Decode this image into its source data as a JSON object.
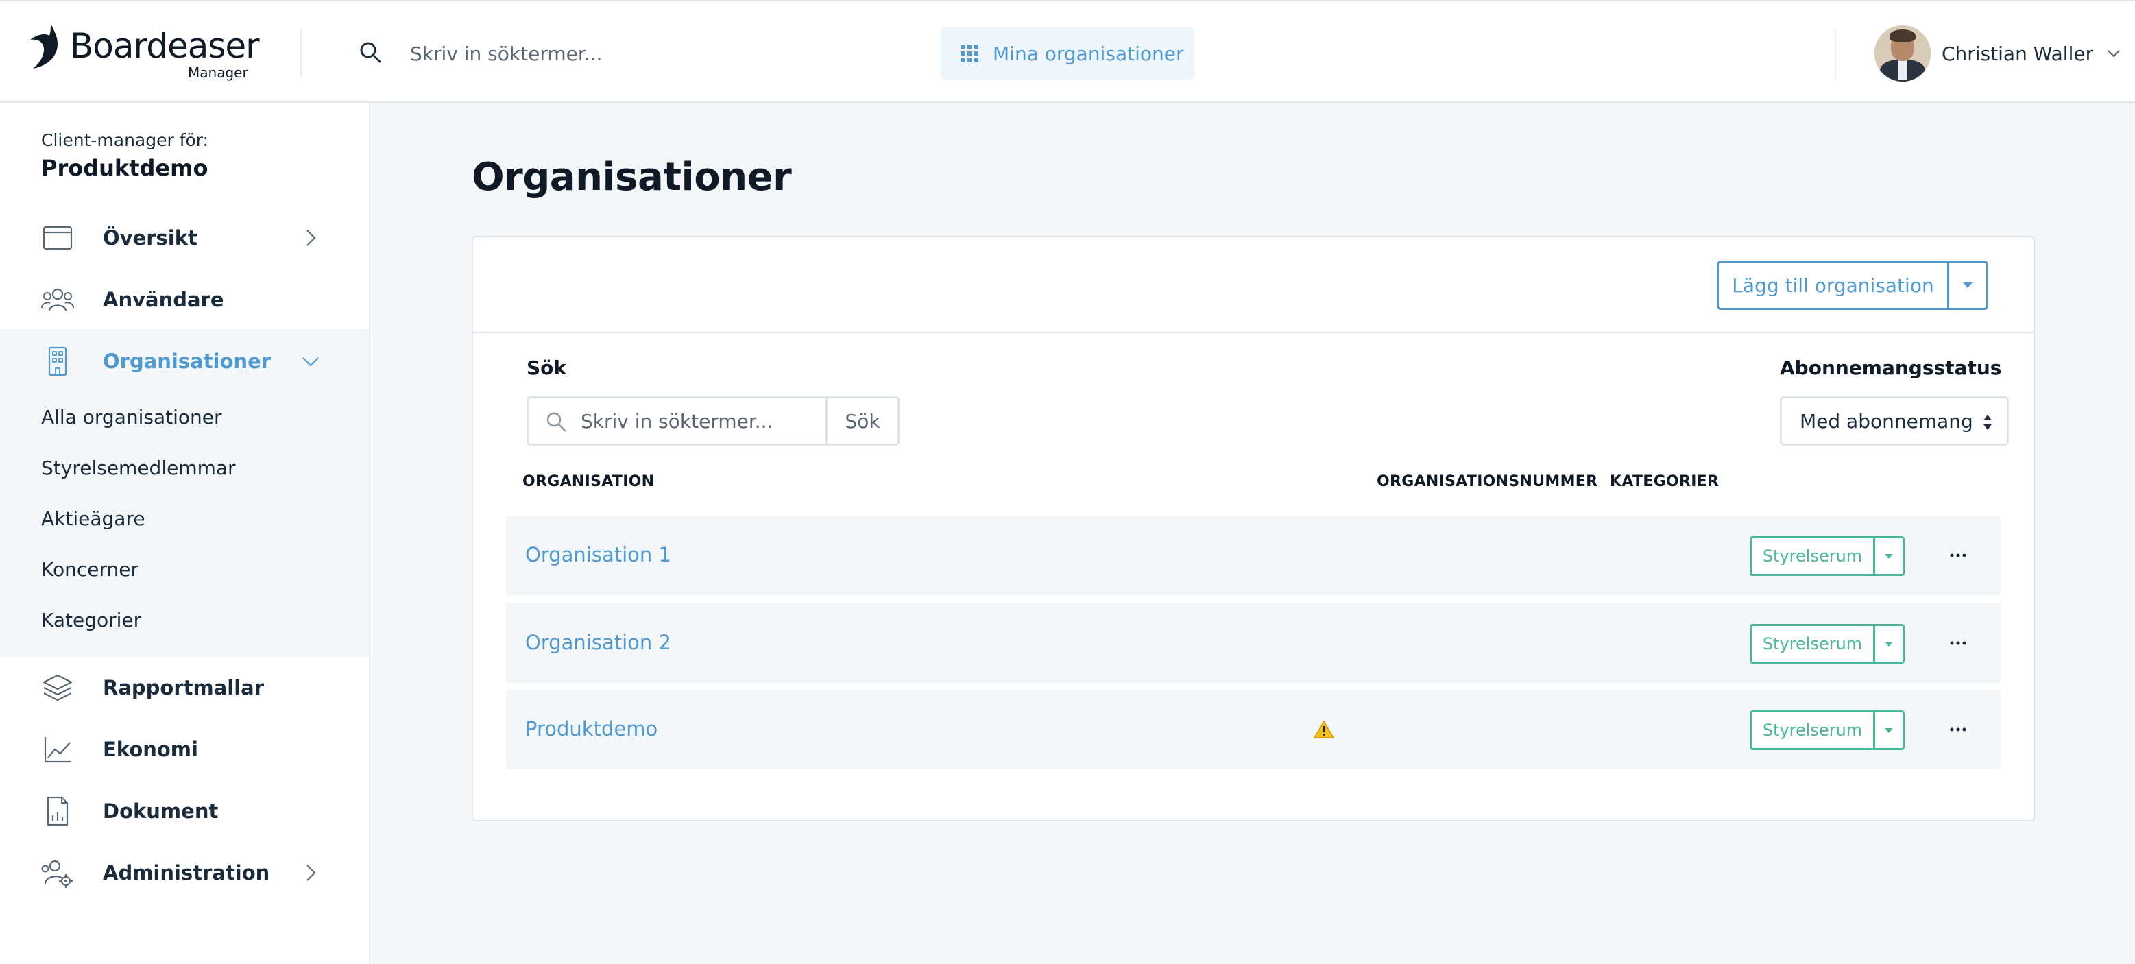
{
  "header": {
    "brand": "Boardeaser",
    "brand_sub": "Manager",
    "search_placeholder": "Skriv in söktermer...",
    "my_orgs_label": "Mina organisationer",
    "user_name": "Christian Waller",
    "accent_color": "#4f9ad0"
  },
  "sidebar": {
    "client_manager_label": "Client-manager för:",
    "client_manager_org": "Produktdemo",
    "items": [
      {
        "label": "Översikt",
        "icon": "browser-window-icon",
        "chevron": "right"
      },
      {
        "label": "Användare",
        "icon": "users-icon"
      },
      {
        "label": "Organisationer",
        "icon": "building-icon",
        "chevron": "down",
        "active": true
      },
      {
        "label": "Rapportmallar",
        "icon": "layers-icon"
      },
      {
        "label": "Ekonomi",
        "icon": "line-chart-icon"
      },
      {
        "label": "Dokument",
        "icon": "document-chart-icon"
      },
      {
        "label": "Administration",
        "icon": "users-gear-icon",
        "chevron": "right"
      }
    ],
    "org_subitems": [
      "Alla organisationer",
      "Styrelsemedlemmar",
      "Aktieägare",
      "Koncerner",
      "Kategorier"
    ]
  },
  "main": {
    "title": "Organisationer",
    "add_org_label": "Lägg till organisation",
    "search_label": "Sök",
    "search_placeholder": "Skriv in söktermer...",
    "search_button": "Sök",
    "subscription_label": "Abonnemangsstatus",
    "subscription_value": "Med abonnemang",
    "columns": [
      "ORGANISATION",
      "ORGANISATIONSNUMMER",
      "KATEGORIER"
    ],
    "rows": [
      {
        "name": "Organisation 1",
        "warning": false,
        "action": "Styrelserum"
      },
      {
        "name": "Organisation 2",
        "warning": false,
        "action": "Styrelserum"
      },
      {
        "name": "Produktdemo",
        "warning": true,
        "action": "Styrelserum"
      }
    ],
    "action_color": "#49b79a"
  }
}
